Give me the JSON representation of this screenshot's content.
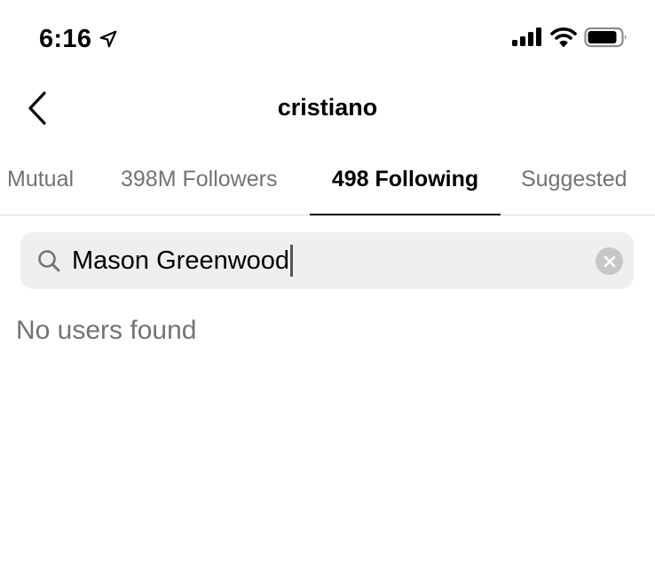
{
  "status_bar": {
    "time": "6:16",
    "icons": [
      "location-arrow-icon",
      "cellular-signal-icon",
      "wifi-icon",
      "battery-icon"
    ]
  },
  "header": {
    "title": "cristiano",
    "back_icon": "chevron-left-icon"
  },
  "tabs": [
    {
      "label": "Mutual",
      "active": false
    },
    {
      "label": "398M Followers",
      "active": false
    },
    {
      "label": "498 Following",
      "active": true
    },
    {
      "label": "Suggested",
      "active": false
    }
  ],
  "search": {
    "value": "Mason Greenwood",
    "icon": "search-icon",
    "clear_icon": "clear-icon"
  },
  "results": {
    "empty_message": "No users found"
  },
  "colors": {
    "background": "#ffffff",
    "text_primary": "#000000",
    "text_secondary": "#737373",
    "search_bg": "#efefef",
    "divider": "#dbdbdb"
  }
}
